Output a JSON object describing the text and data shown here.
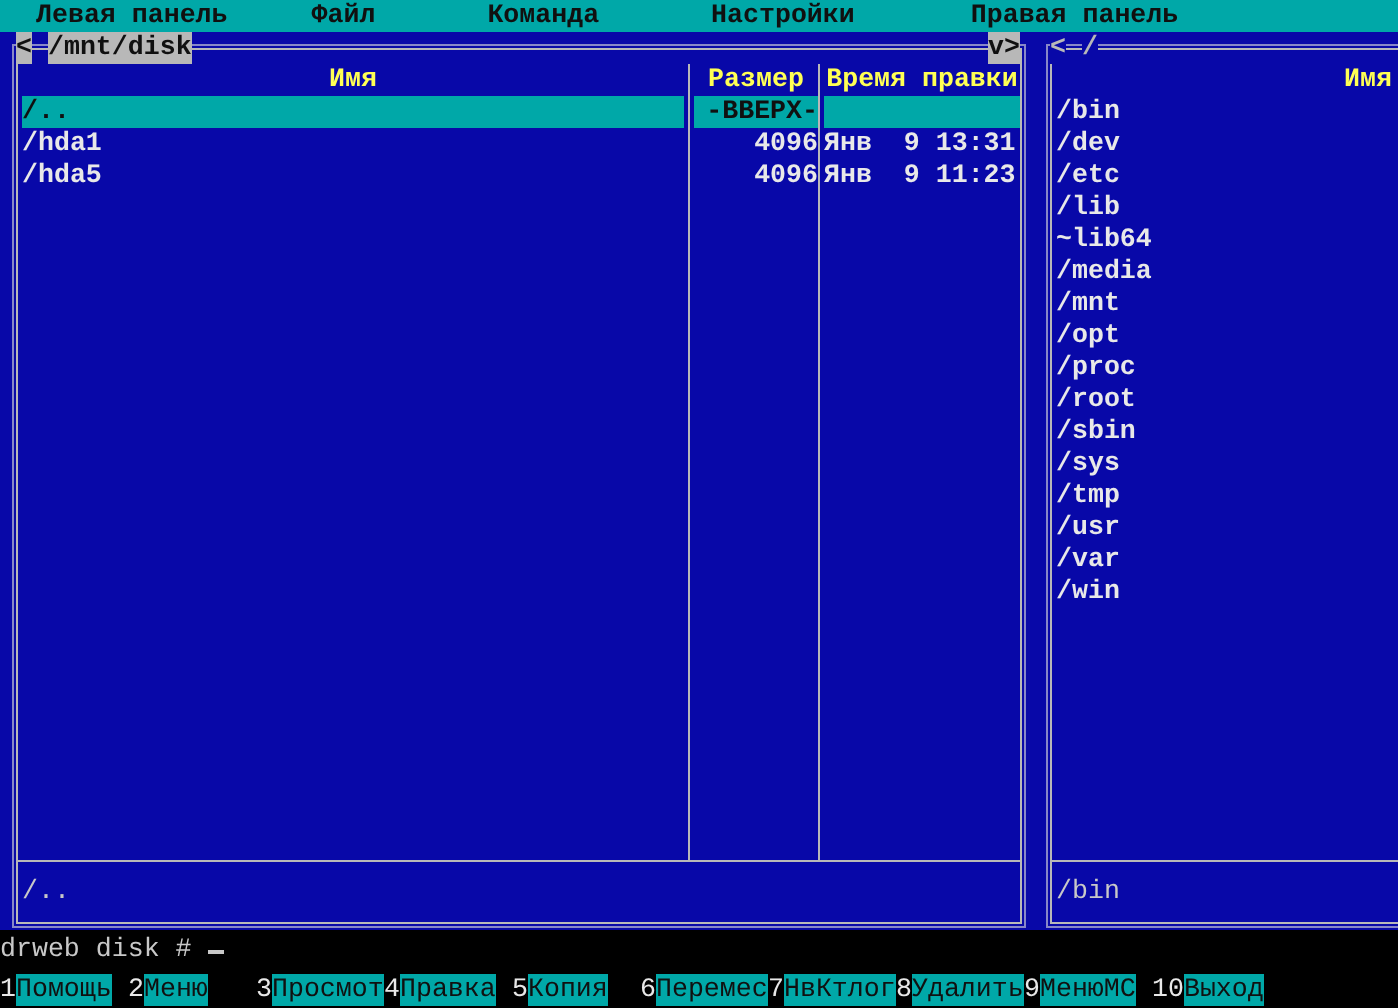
{
  "menu_bar": [
    "Левая панель",
    "Файл",
    "Команда",
    "Настройки",
    "Правая панель"
  ],
  "left_panel": {
    "active": true,
    "left_marker": "<",
    "path": "/mnt/disk",
    "right_marker": "v>",
    "columns": [
      "Имя",
      "Размер",
      "Время правки"
    ],
    "rows": [
      {
        "name": "/..",
        "size": "-ВВЕРХ-",
        "selected": true
      },
      {
        "name": "/hda1",
        "size": "4096",
        "time": "Янв  9 13:31",
        "selected": false
      },
      {
        "name": "/hda5",
        "size": "4096",
        "time": "Янв  9 11:23",
        "selected": false
      }
    ],
    "status": "/.."
  },
  "right_panel": {
    "active": false,
    "left_marker": "<",
    "path": "/",
    "columns": [
      "Имя"
    ],
    "items": [
      "/bin",
      "/dev",
      "/etc",
      "/lib",
      "~lib64",
      "/media",
      "/mnt",
      "/opt",
      "/proc",
      "/root",
      "/sbin",
      "/sys",
      "/tmp",
      "/usr",
      "/var",
      "/win"
    ],
    "status": "/bin"
  },
  "command_line": {
    "prompt": "drweb disk #"
  },
  "key_bar": [
    {
      "key": "1",
      "label": "Помощь"
    },
    {
      "key": "2",
      "label": "Меню"
    },
    {
      "key": "3",
      "label": "Просмот"
    },
    {
      "key": "4",
      "label": "Правка"
    },
    {
      "key": "5",
      "label": "Копия"
    },
    {
      "key": "6",
      "label": "Перемес"
    },
    {
      "key": "7",
      "label": "НвКтлог"
    },
    {
      "key": "8",
      "label": "Удалить"
    },
    {
      "key": "9",
      "label": "МенюМС"
    },
    {
      "key": "10",
      "label": "Выход"
    }
  ]
}
